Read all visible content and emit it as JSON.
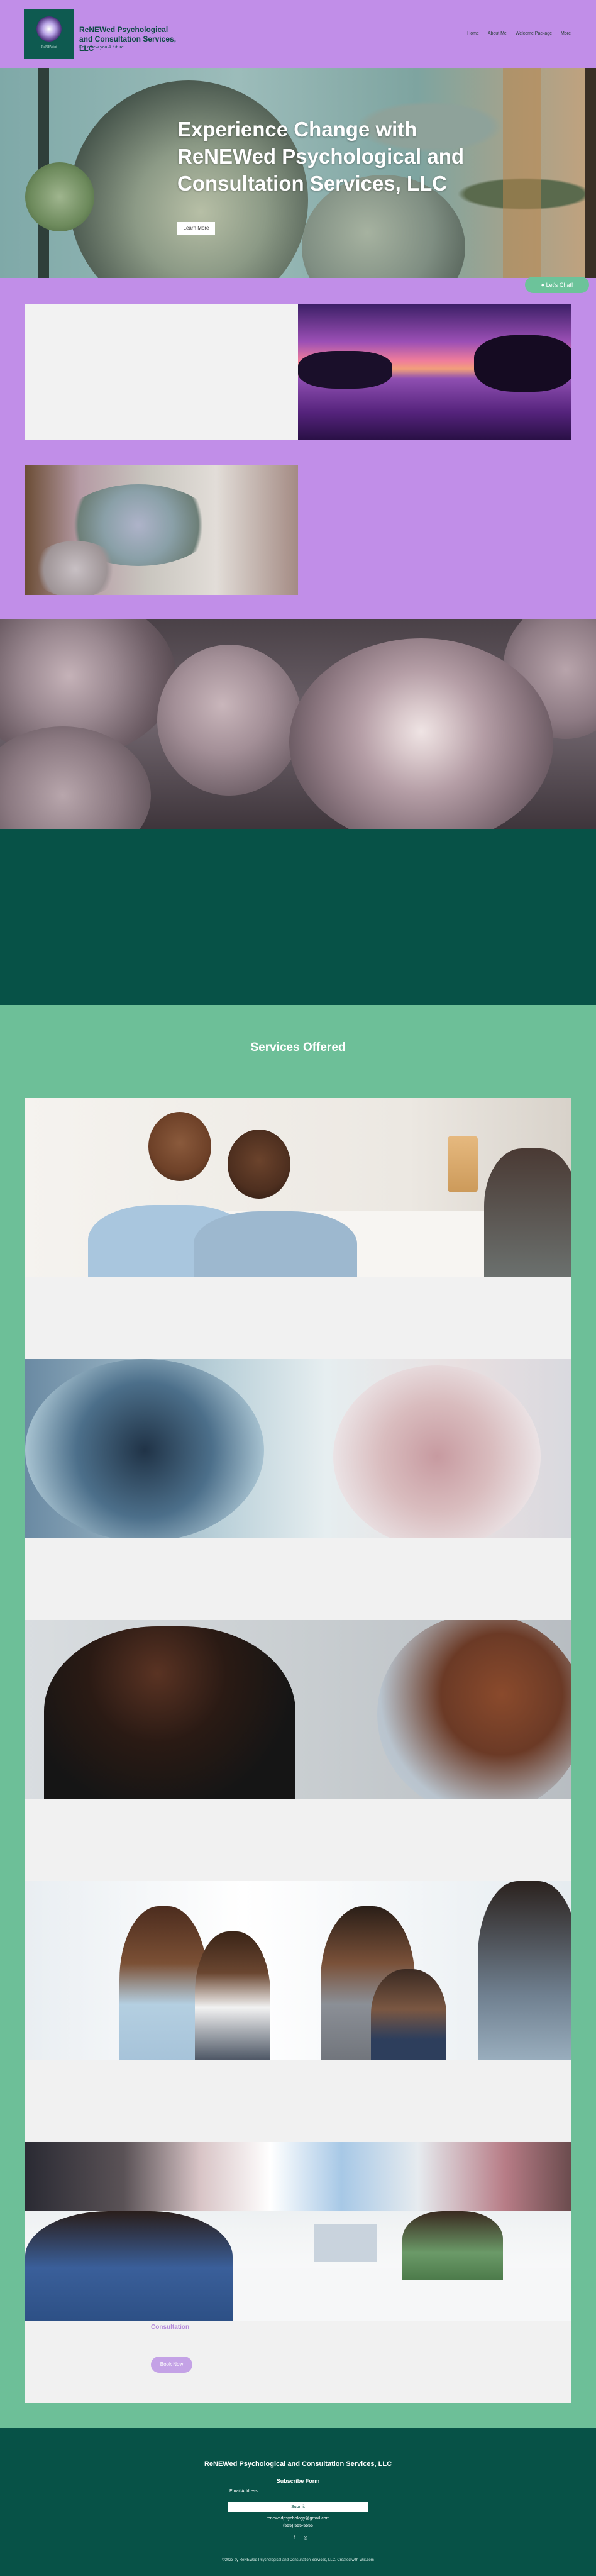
{
  "header": {
    "site_title": "ReNEWed Psychological and Consultation Services, LLC",
    "site_subtitle": "For a new you & future",
    "logo_tagline": "ReNEWed",
    "nav": [
      "Home",
      "About Me",
      "Welcome Package",
      "More"
    ]
  },
  "hero": {
    "title": "Experience Change with ReNEWed Psychological and Consultation Services, LLC",
    "button": "Learn More"
  },
  "chat": {
    "label": "Let's Chat!"
  },
  "intro": {
    "link": ""
  },
  "services": {
    "title": "Services Offered",
    "last_item_heading": "Consultation",
    "last_item_button": "Book Now"
  },
  "footer": {
    "title": "ReNEWed Psychological and Consultation Services, LLC",
    "subscribe_title": "Subscribe Form",
    "email_label": "Email Address",
    "submit": "Submit",
    "email": "renewedpsychology@gmail.com",
    "phone": "(555) 555-5555",
    "social_1": "f",
    "social_2": "◎",
    "copyright": "©2023 by ReNEWed Psychological and Consultation Services, LLC. Created with Wix.com"
  },
  "colors": {
    "header_bg": "#c18ee8",
    "dark_teal": "#075247",
    "services_green": "#6dbf98",
    "accent_purple": "#b48bd9"
  }
}
